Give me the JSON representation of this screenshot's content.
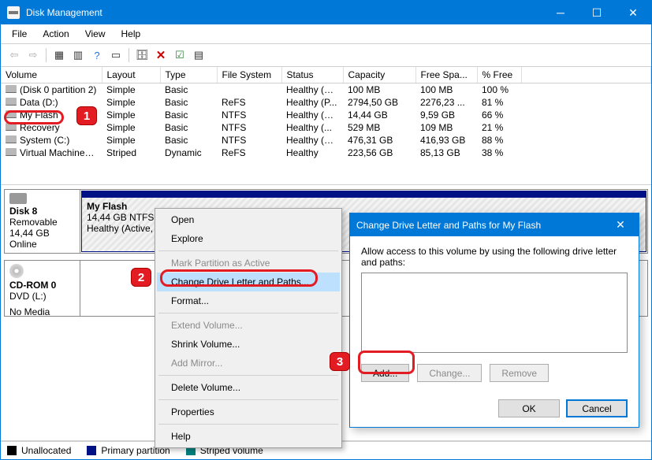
{
  "window": {
    "title": "Disk Management"
  },
  "menu": {
    "file": "File",
    "action": "Action",
    "view": "View",
    "help": "Help"
  },
  "columns": {
    "volume": "Volume",
    "layout": "Layout",
    "type": "Type",
    "fs": "File System",
    "status": "Status",
    "capacity": "Capacity",
    "free": "Free Spa...",
    "pct": "% Free"
  },
  "volumes": [
    {
      "name": "(Disk 0 partition 2)",
      "layout": "Simple",
      "type": "Basic",
      "fs": "",
      "status": "Healthy (E...",
      "cap": "100 MB",
      "free": "100 MB",
      "pct": "100 %"
    },
    {
      "name": "Data (D:)",
      "layout": "Simple",
      "type": "Basic",
      "fs": "ReFS",
      "status": "Healthy (P...",
      "cap": "2794,50 GB",
      "free": "2276,23 ...",
      "pct": "81 %"
    },
    {
      "name": "My Flash",
      "layout": "Simple",
      "type": "Basic",
      "fs": "NTFS",
      "status": "Healthy (A...",
      "cap": "14,44 GB",
      "free": "9,59 GB",
      "pct": "66 %"
    },
    {
      "name": "Recovery",
      "layout": "Simple",
      "type": "Basic",
      "fs": "NTFS",
      "status": "Healthy (...",
      "cap": "529 MB",
      "free": "109 MB",
      "pct": "21 %"
    },
    {
      "name": "System (C:)",
      "layout": "Simple",
      "type": "Basic",
      "fs": "NTFS",
      "status": "Healthy (B...",
      "cap": "476,31 GB",
      "free": "416,93 GB",
      "pct": "88 %"
    },
    {
      "name": "Virtual Machines (...",
      "layout": "Striped",
      "type": "Dynamic",
      "fs": "ReFS",
      "status": "Healthy",
      "cap": "223,56 GB",
      "free": "85,13 GB",
      "pct": "38 %"
    }
  ],
  "disks": {
    "d8": {
      "name": "Disk 8",
      "kind": "Removable",
      "size": "14,44 GB",
      "state": "Online",
      "part_name": "My Flash",
      "part_size": "14,44 GB NTFS",
      "part_status": "Healthy (Active, Primary Partition)"
    },
    "cd": {
      "name": "CD-ROM 0",
      "kind": "DVD (L:)",
      "state": "No Media"
    }
  },
  "legend": {
    "unalloc": "Unallocated",
    "primary": "Primary partition",
    "striped": "Striped volume"
  },
  "ctx": {
    "open": "Open",
    "explore": "Explore",
    "mark": "Mark Partition as Active",
    "change": "Change Drive Letter and Paths...",
    "format": "Format...",
    "extend": "Extend Volume...",
    "shrink": "Shrink Volume...",
    "mirror": "Add Mirror...",
    "delete": "Delete Volume...",
    "props": "Properties",
    "help": "Help"
  },
  "dialog": {
    "title": "Change Drive Letter and Paths for My Flash",
    "text": "Allow access to this volume by using the following drive letter and paths:",
    "add": "Add...",
    "change": "Change...",
    "remove": "Remove",
    "ok": "OK",
    "cancel": "Cancel"
  },
  "callouts": {
    "one": "1",
    "two": "2",
    "three": "3"
  }
}
